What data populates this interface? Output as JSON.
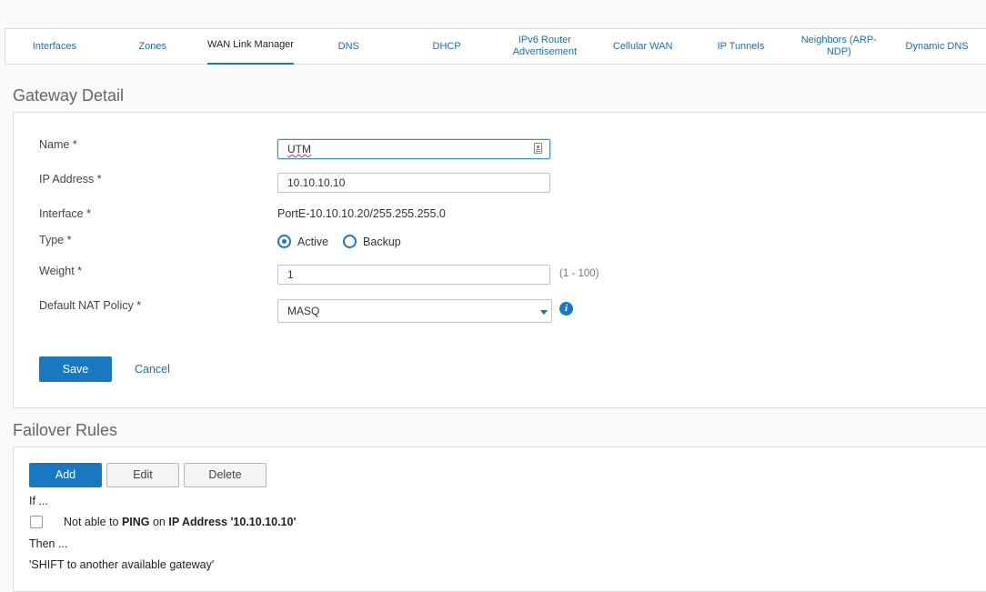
{
  "tabs": [
    {
      "label": "Interfaces",
      "active": false
    },
    {
      "label": "Zones",
      "active": false
    },
    {
      "label": "WAN Link Manager",
      "active": true
    },
    {
      "label": "DNS",
      "active": false
    },
    {
      "label": "DHCP",
      "active": false
    },
    {
      "label": "IPv6 Router Advertisement",
      "active": false
    },
    {
      "label": "Cellular WAN",
      "active": false
    },
    {
      "label": "IP Tunnels",
      "active": false
    },
    {
      "label": "Neighbors (ARP-NDP)",
      "active": false
    },
    {
      "label": "Dynamic DNS",
      "active": false
    }
  ],
  "gateway_detail": {
    "title": "Gateway Detail",
    "name_label": "Name *",
    "name_value": "UTM",
    "ip_label": "IP Address *",
    "ip_value": "10.10.10.10",
    "interface_label": "Interface *",
    "interface_value": "PortE-10.10.10.20/255.255.255.0",
    "type_label": "Type *",
    "type_options": [
      "Active",
      "Backup"
    ],
    "type_selected": "Active",
    "weight_label": "Weight *",
    "weight_value": "1",
    "weight_range": "(1 - 100)",
    "nat_label": "Default NAT Policy *",
    "nat_value": "MASQ",
    "save_label": "Save",
    "cancel_label": "Cancel"
  },
  "failover": {
    "title": "Failover Rules",
    "add_label": "Add",
    "edit_label": "Edit",
    "delete_label": "Delete",
    "if_label": "If ...",
    "rule": {
      "prefix": "Not able to ",
      "method": "PING",
      "middle": " on ",
      "target": "IP Address '10.10.10.10'"
    },
    "then_label": "Then ...",
    "action": "'SHIFT to another available gateway'"
  },
  "colors": {
    "accent": "#1a78c2",
    "link": "#1a6fb3"
  }
}
